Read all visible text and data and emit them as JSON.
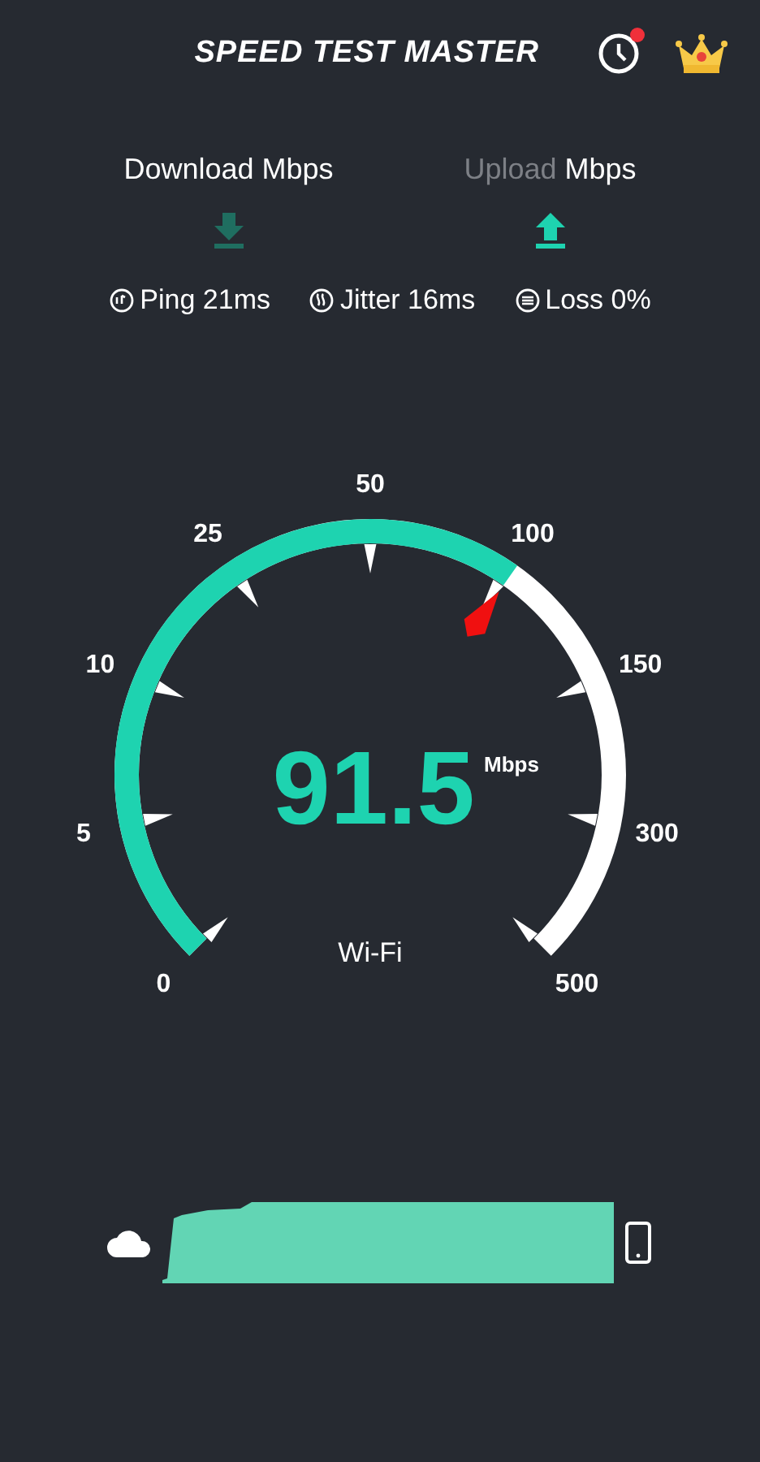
{
  "header": {
    "title": "SPEED TEST MASTER",
    "history_badge": true
  },
  "tabs": [
    {
      "name": "Download",
      "unit": "Mbps",
      "selected": false
    },
    {
      "name": "Upload",
      "unit": "Mbps",
      "selected": true
    }
  ],
  "stats": [
    {
      "kind": "ping",
      "text": "Ping 21ms"
    },
    {
      "kind": "jitter",
      "text": "Jitter 16ms"
    },
    {
      "kind": "loss",
      "text": "Loss 0%"
    }
  ],
  "gauge": {
    "scale": [
      "0",
      "5",
      "10",
      "25",
      "50",
      "100",
      "150",
      "300",
      "500"
    ],
    "value": "91.5",
    "unit": "Mbps",
    "network": "Wi-Fi"
  }
}
